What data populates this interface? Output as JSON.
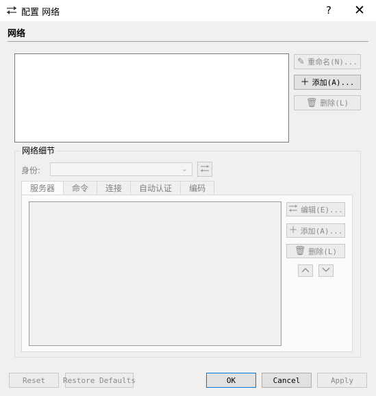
{
  "window": {
    "title": "配置 网络",
    "help_label": "?",
    "close_label": "✕"
  },
  "network": {
    "section_title": "网络",
    "buttons": {
      "rename": "重命名(N)...",
      "add": "添加(A)...",
      "delete": "删除(L)"
    }
  },
  "details": {
    "group_label": "网络细节",
    "identity_label": "身份:",
    "identity_value": "",
    "tabs": [
      {
        "label": "服务器"
      },
      {
        "label": "命令"
      },
      {
        "label": "连接"
      },
      {
        "label": "自动认证"
      },
      {
        "label": "编码"
      }
    ],
    "buttons": {
      "edit": "编辑(E)...",
      "add": "添加(A)...",
      "delete": "删除(L)"
    }
  },
  "footer": {
    "reset": "Reset",
    "restore_defaults": "Restore Defaults",
    "ok": "OK",
    "cancel": "Cancel",
    "apply": "Apply"
  },
  "icons": {
    "title": "sliders-icon",
    "rename": "pencil-icon",
    "add": "plus-icon",
    "delete": "trash-icon",
    "edit": "sliders-icon",
    "up": "chevron-up-icon",
    "down": "chevron-down-icon"
  }
}
